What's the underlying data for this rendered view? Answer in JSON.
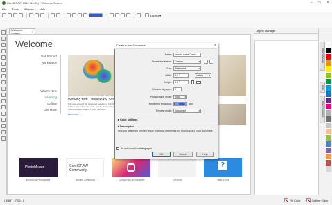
{
  "app": {
    "title": "CorelDRAW 2019 (64-Bit) - Welcome Screen"
  },
  "menu": [
    "File",
    "Tools",
    "Window",
    "Help"
  ],
  "toolbar": {
    "zoom_value": "",
    "launch_label": "Launch"
  },
  "document_tab": {
    "label": "Welcome Screen"
  },
  "welcome": {
    "title": "Welcome",
    "nav": [
      {
        "label": "Get Started",
        "active": false
      },
      {
        "label": "Workspace",
        "active": false
      },
      {
        "label": "What's New",
        "active": false
      },
      {
        "label": "Learning",
        "active": true
      },
      {
        "label": "Gallery",
        "active": false
      },
      {
        "label": "Get More",
        "active": false
      }
    ],
    "feature_heading": "Working with CorelDRAW Sorti",
    "feature_body": "Discover some of the advanced features in CorelDRAW. Explore new tools, save time, and be amazed by creating different unique shapes in your own work.",
    "feature_more": "Learn more",
    "tiles": [
      {
        "caption": "Introducing PhotoMirage",
        "label": "PhotoMirage",
        "color": "#2b1b3a"
      },
      {
        "caption": "Join the Community",
        "label": "CorelDRAW Community",
        "color": "#ffffff"
      },
      {
        "caption": "CorelDRAW on Instagram",
        "label": "",
        "color": "#d62976"
      },
      {
        "caption": "Get more",
        "label": "",
        "color": "#f2f2f2"
      },
      {
        "caption": "Hints & Tips",
        "label": "?",
        "color": "#2a8be0"
      }
    ]
  },
  "dialog": {
    "title": "Create a New Document",
    "fields": {
      "name_label": "Name:",
      "name_value": "How to make Cards",
      "preset_label": "Preset destination:",
      "preset_value": "Custom",
      "size_label": "Size:",
      "size_value": "Statement",
      "width_label": "Width:",
      "width_value": "8.5 \"",
      "units_value": "inches",
      "height_label": "Height:",
      "height_value": "5.5 \"",
      "pages_label": "Number of pages:",
      "pages_value": "2",
      "color_mode_label": "Primary color mode:",
      "color_mode_value": "RGB",
      "resolution_label": "Rendering resolution:",
      "resolution_value": "300",
      "resolution_unit": "dpi",
      "preview_label": "Preview mode:",
      "preview_value": "Enhanced"
    },
    "color_settings_label": "Color settings",
    "description_label": "Description",
    "description_text": "Lets you select the preview mode that most resembles the final output of your document.",
    "dont_show_label": "Do not show this dialog again",
    "buttons": {
      "ok": "OK",
      "cancel": "Cancel",
      "help": "Help"
    }
  },
  "object_manager": {
    "title": "Object Manager"
  },
  "side_tabs": [
    "Object Manager",
    "Hints",
    "Object Properties"
  ],
  "palette": [
    "#ffffff",
    "#000000",
    "#e30613",
    "#f39200",
    "#ffed00",
    "#95c11f",
    "#009640",
    "#00a0e3",
    "#1d71b8",
    "#662483",
    "#e6007e",
    "#b2b2b2",
    "#706f6f",
    "#c6c6c6",
    "#fabf8f",
    "#9bbb59",
    "#4f81bd",
    "#8064a2",
    "#f79646",
    "#c0504d",
    "#d9d9d9"
  ],
  "status": {
    "coords": "( 8.837 , 7.051 )",
    "fill_label": "Fill Color",
    "outline_label": "Outline Color"
  }
}
